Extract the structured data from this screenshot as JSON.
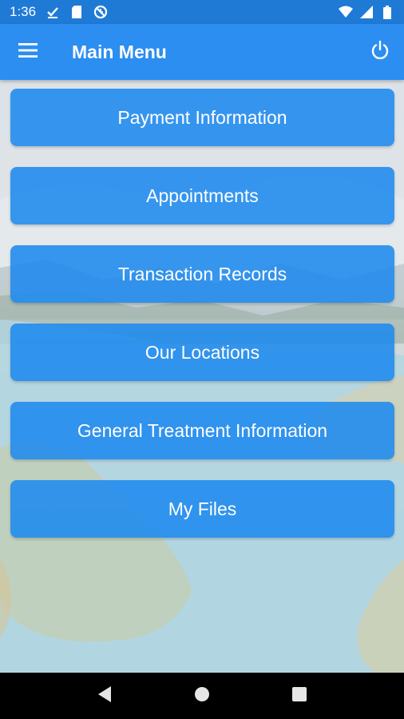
{
  "status_bar": {
    "time": "1:36",
    "icons": [
      "download-done-icon",
      "sd-card-icon",
      "sync-disabled-icon",
      "wifi-icon",
      "cellular-signal-icon",
      "battery-icon"
    ]
  },
  "app_bar": {
    "title": "Main Menu",
    "left_icon": "hamburger-menu-icon",
    "right_icon": "power-icon"
  },
  "menu": {
    "items": [
      {
        "label": "Payment Information"
      },
      {
        "label": "Appointments"
      },
      {
        "label": "Transaction Records"
      },
      {
        "label": "Our Locations"
      },
      {
        "label": "General Treatment Information"
      },
      {
        "label": "My Files"
      }
    ]
  },
  "colors": {
    "status_bar": "#1f7ad6",
    "app_bar": "#2b8ef0",
    "button": "#1e8aee"
  },
  "nav_bar": {
    "buttons": [
      "back-icon",
      "home-icon",
      "recents-icon"
    ]
  }
}
